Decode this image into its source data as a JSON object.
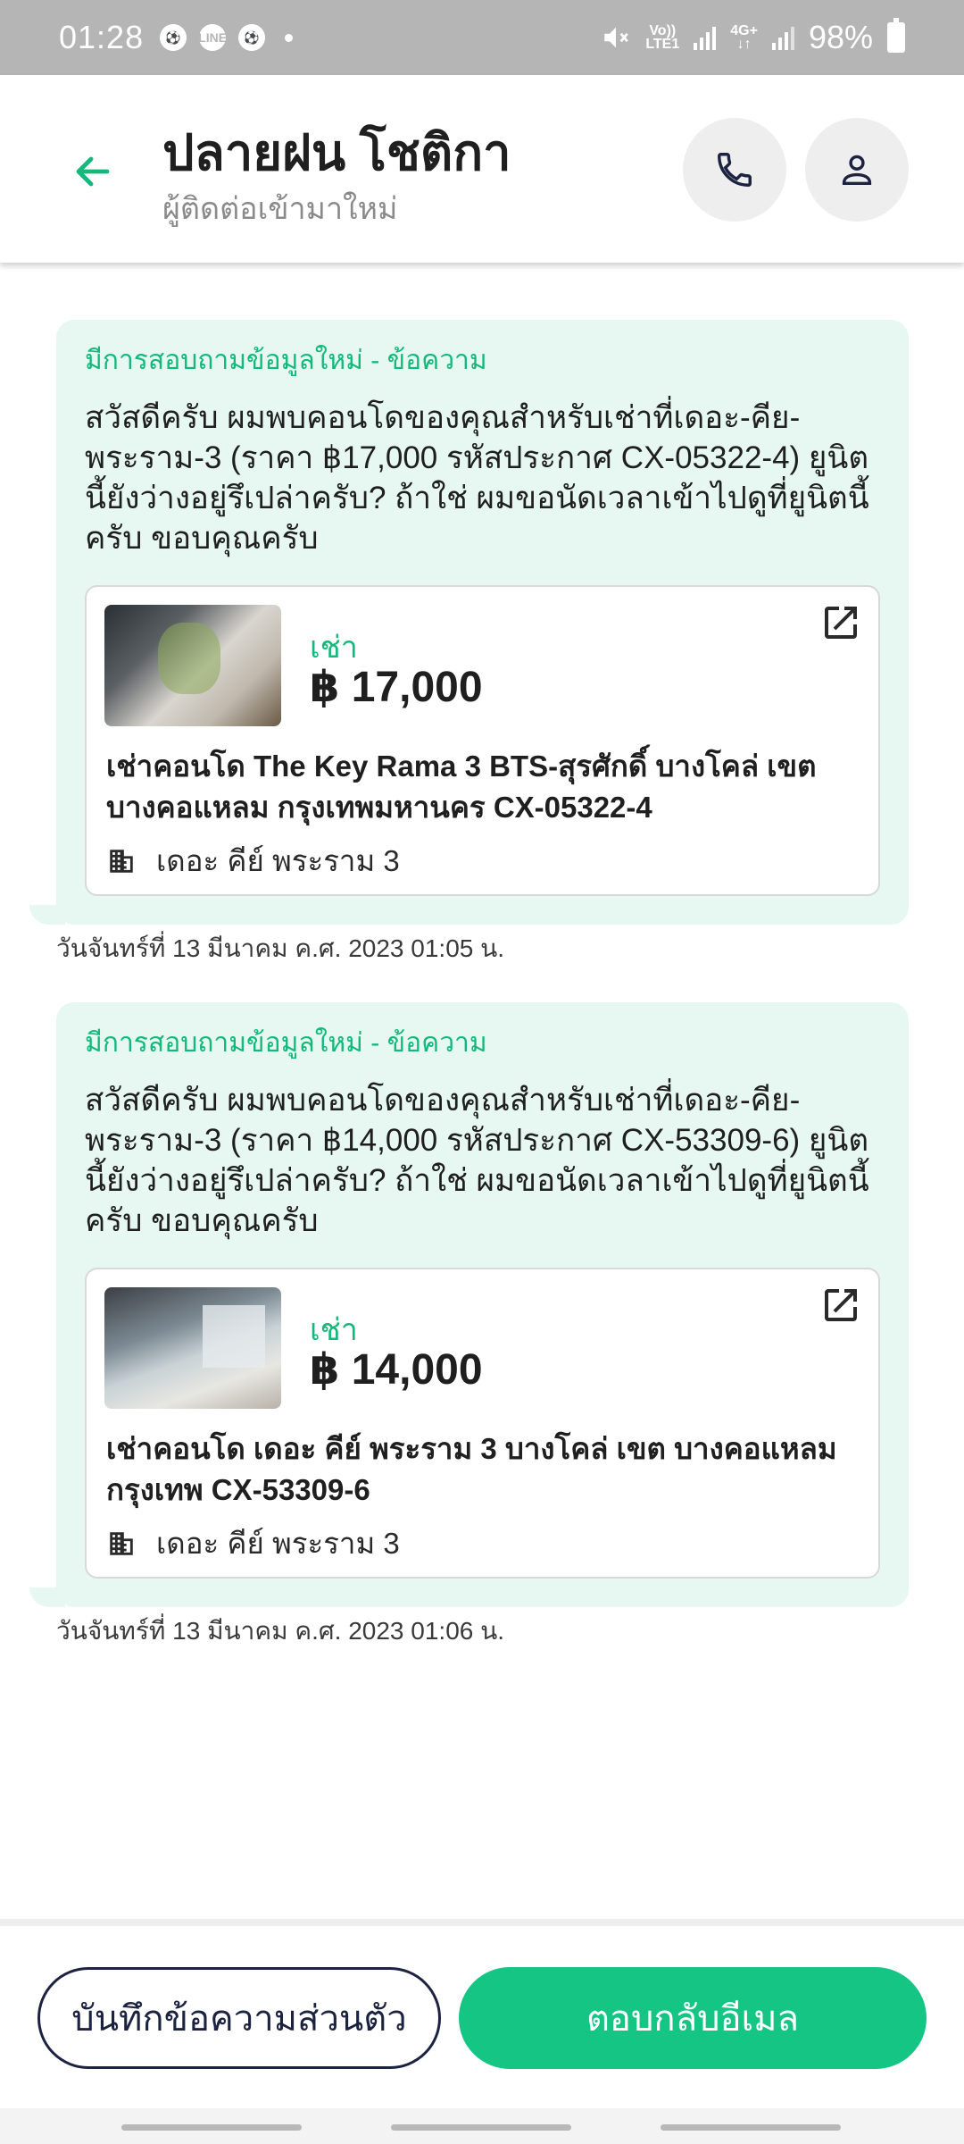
{
  "status_bar": {
    "time": "01:28",
    "battery": "98%",
    "network_top": "Vo))",
    "network_bottom": "LTE1",
    "net2_top": "4G+",
    "net2_bottom": "↓↑",
    "icons": [
      "soccer-ball-icon",
      "line-chat-icon",
      "soccer-ball-icon",
      "notification-dot-icon",
      "mute-icon",
      "signal-icon",
      "battery-icon"
    ]
  },
  "header": {
    "title": "ปลายฝน โชติกา",
    "subtitle": "ผู้ติดต่อเข้ามาใหม่",
    "accent_color": "#12b97a"
  },
  "messages": [
    {
      "heading": "มีการสอบถามข้อมูลใหม่ - ข้อความ",
      "text": "สวัสดีครับ ผมพบคอนโดของคุณสำหรับเช่าที่เดอะ-คีย-พระราม-3 (ราคา ฿17,000 รหัสประกาศ CX-05322-4) ยูนิตนี้ยังว่างอยู่รึเปล่าครับ? ถ้าใช่ ผมขอนัดเวลาเข้าไปดูที่ยูนิตนี้ครับ ขอบคุณครับ",
      "listing": {
        "type_label": "เช่า",
        "price": "฿ 17,000",
        "title": "เช่าคอนโด  The Key Rama 3 BTS-สุรศักดิ์ บางโคล่ เขต บางคอแหลม กรุงเทพมหานคร CX-05322-4",
        "project": "เดอะ คีย์ พระราม 3"
      },
      "timestamp": "วันจันทร์ที่ 13 มีนาคม ค.ศ. 2023 01:05 น."
    },
    {
      "heading": "มีการสอบถามข้อมูลใหม่ - ข้อความ",
      "text": "สวัสดีครับ ผมพบคอนโดของคุณสำหรับเช่าที่เดอะ-คีย-พระราม-3 (ราคา ฿14,000 รหัสประกาศ CX-53309-6) ยูนิตนี้ยังว่างอยู่รึเปล่าครับ? ถ้าใช่ ผมขอนัดเวลาเข้าไปดูที่ยูนิตนี้ครับ ขอบคุณครับ",
      "listing": {
        "type_label": "เช่า",
        "price": "฿ 14,000",
        "title": "เช่าคอนโด  เดอะ คีย์ พระราม 3 บางโคล่ เขต บางคอแหลม กรุงเทพ CX-53309-6",
        "project": "เดอะ คีย์ พระราม 3"
      },
      "timestamp": "วันจันทร์ที่ 13 มีนาคม ค.ศ. 2023 01:06 น."
    }
  ],
  "actions": {
    "private_note_label": "บันทึกข้อความส่วนตัว",
    "reply_email_label": "ตอบกลับอีเมล",
    "primary_color": "#14c584"
  }
}
